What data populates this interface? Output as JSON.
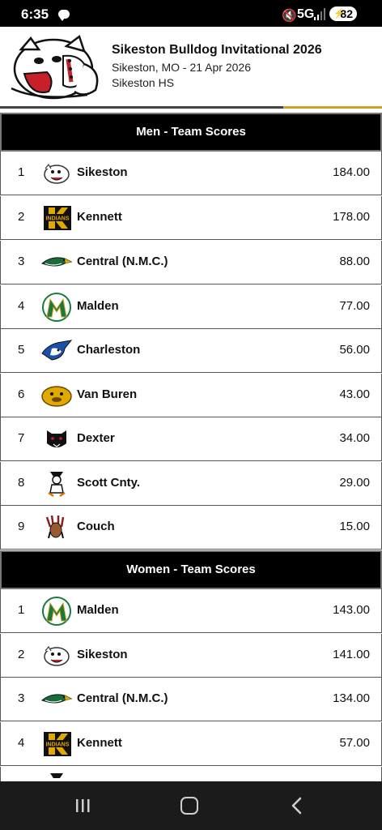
{
  "status": {
    "time": "6:35",
    "network": "5G",
    "battery": "82"
  },
  "meet": {
    "title": "Sikeston Bulldog Invitational 2026",
    "location_date": "Sikeston, MO - 21 Apr 2026",
    "venue": "Sikeston HS"
  },
  "men": {
    "heading": "Men - Team Scores",
    "rows": [
      {
        "rank": "1",
        "team": "Sikeston",
        "score": "184.00",
        "logo": "bulldog-logo"
      },
      {
        "rank": "2",
        "team": "Kennett",
        "score": "178.00",
        "logo": "kennett-k-logo",
        "logo_text": "INDIANS"
      },
      {
        "rank": "3",
        "team": "Central (N.M.C.)",
        "score": "88.00",
        "logo": "eagle-logo"
      },
      {
        "rank": "4",
        "team": "Malden",
        "score": "77.00",
        "logo": "malden-m-logo"
      },
      {
        "rank": "5",
        "team": "Charleston",
        "score": "56.00",
        "logo": "bluejay-logo"
      },
      {
        "rank": "6",
        "team": "Van Buren",
        "score": "43.00",
        "logo": "gold-bulldog-logo"
      },
      {
        "rank": "7",
        "team": "Dexter",
        "score": "34.00",
        "logo": "panther-logo"
      },
      {
        "rank": "8",
        "team": "Scott Cnty.",
        "score": "29.00",
        "logo": "rebel-logo"
      },
      {
        "rank": "9",
        "team": "Couch",
        "score": "15.00",
        "logo": "indian-head-logo"
      }
    ]
  },
  "women": {
    "heading": "Women - Team Scores",
    "rows": [
      {
        "rank": "1",
        "team": "Malden",
        "score": "143.00",
        "logo": "malden-m-logo"
      },
      {
        "rank": "2",
        "team": "Sikeston",
        "score": "141.00",
        "logo": "bulldog-logo"
      },
      {
        "rank": "3",
        "team": "Central (N.M.C.)",
        "score": "134.00",
        "logo": "eagle-logo"
      },
      {
        "rank": "4",
        "team": "Kennett",
        "score": "57.00",
        "logo": "kennett-k-logo",
        "logo_text": "INDIANS"
      }
    ]
  },
  "colors": {
    "header_bar": "#000000",
    "accent_gold": "#c9a227",
    "sikeston_red": "#c8202a"
  }
}
